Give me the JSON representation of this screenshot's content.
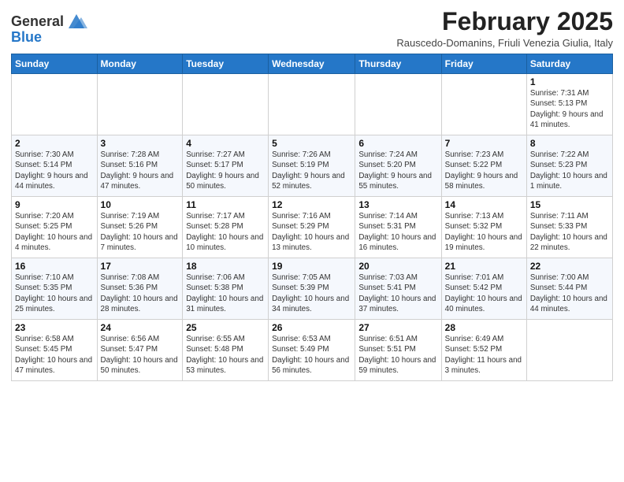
{
  "header": {
    "logo_general": "General",
    "logo_blue": "Blue",
    "month_title": "February 2025",
    "subtitle": "Rauscedo-Domanins, Friuli Venezia Giulia, Italy"
  },
  "weekdays": [
    "Sunday",
    "Monday",
    "Tuesday",
    "Wednesday",
    "Thursday",
    "Friday",
    "Saturday"
  ],
  "weeks": [
    [
      {
        "day": "",
        "info": ""
      },
      {
        "day": "",
        "info": ""
      },
      {
        "day": "",
        "info": ""
      },
      {
        "day": "",
        "info": ""
      },
      {
        "day": "",
        "info": ""
      },
      {
        "day": "",
        "info": ""
      },
      {
        "day": "1",
        "info": "Sunrise: 7:31 AM\nSunset: 5:13 PM\nDaylight: 9 hours and 41 minutes."
      }
    ],
    [
      {
        "day": "2",
        "info": "Sunrise: 7:30 AM\nSunset: 5:14 PM\nDaylight: 9 hours and 44 minutes."
      },
      {
        "day": "3",
        "info": "Sunrise: 7:28 AM\nSunset: 5:16 PM\nDaylight: 9 hours and 47 minutes."
      },
      {
        "day": "4",
        "info": "Sunrise: 7:27 AM\nSunset: 5:17 PM\nDaylight: 9 hours and 50 minutes."
      },
      {
        "day": "5",
        "info": "Sunrise: 7:26 AM\nSunset: 5:19 PM\nDaylight: 9 hours and 52 minutes."
      },
      {
        "day": "6",
        "info": "Sunrise: 7:24 AM\nSunset: 5:20 PM\nDaylight: 9 hours and 55 minutes."
      },
      {
        "day": "7",
        "info": "Sunrise: 7:23 AM\nSunset: 5:22 PM\nDaylight: 9 hours and 58 minutes."
      },
      {
        "day": "8",
        "info": "Sunrise: 7:22 AM\nSunset: 5:23 PM\nDaylight: 10 hours and 1 minute."
      }
    ],
    [
      {
        "day": "9",
        "info": "Sunrise: 7:20 AM\nSunset: 5:25 PM\nDaylight: 10 hours and 4 minutes."
      },
      {
        "day": "10",
        "info": "Sunrise: 7:19 AM\nSunset: 5:26 PM\nDaylight: 10 hours and 7 minutes."
      },
      {
        "day": "11",
        "info": "Sunrise: 7:17 AM\nSunset: 5:28 PM\nDaylight: 10 hours and 10 minutes."
      },
      {
        "day": "12",
        "info": "Sunrise: 7:16 AM\nSunset: 5:29 PM\nDaylight: 10 hours and 13 minutes."
      },
      {
        "day": "13",
        "info": "Sunrise: 7:14 AM\nSunset: 5:31 PM\nDaylight: 10 hours and 16 minutes."
      },
      {
        "day": "14",
        "info": "Sunrise: 7:13 AM\nSunset: 5:32 PM\nDaylight: 10 hours and 19 minutes."
      },
      {
        "day": "15",
        "info": "Sunrise: 7:11 AM\nSunset: 5:33 PM\nDaylight: 10 hours and 22 minutes."
      }
    ],
    [
      {
        "day": "16",
        "info": "Sunrise: 7:10 AM\nSunset: 5:35 PM\nDaylight: 10 hours and 25 minutes."
      },
      {
        "day": "17",
        "info": "Sunrise: 7:08 AM\nSunset: 5:36 PM\nDaylight: 10 hours and 28 minutes."
      },
      {
        "day": "18",
        "info": "Sunrise: 7:06 AM\nSunset: 5:38 PM\nDaylight: 10 hours and 31 minutes."
      },
      {
        "day": "19",
        "info": "Sunrise: 7:05 AM\nSunset: 5:39 PM\nDaylight: 10 hours and 34 minutes."
      },
      {
        "day": "20",
        "info": "Sunrise: 7:03 AM\nSunset: 5:41 PM\nDaylight: 10 hours and 37 minutes."
      },
      {
        "day": "21",
        "info": "Sunrise: 7:01 AM\nSunset: 5:42 PM\nDaylight: 10 hours and 40 minutes."
      },
      {
        "day": "22",
        "info": "Sunrise: 7:00 AM\nSunset: 5:44 PM\nDaylight: 10 hours and 44 minutes."
      }
    ],
    [
      {
        "day": "23",
        "info": "Sunrise: 6:58 AM\nSunset: 5:45 PM\nDaylight: 10 hours and 47 minutes."
      },
      {
        "day": "24",
        "info": "Sunrise: 6:56 AM\nSunset: 5:47 PM\nDaylight: 10 hours and 50 minutes."
      },
      {
        "day": "25",
        "info": "Sunrise: 6:55 AM\nSunset: 5:48 PM\nDaylight: 10 hours and 53 minutes."
      },
      {
        "day": "26",
        "info": "Sunrise: 6:53 AM\nSunset: 5:49 PM\nDaylight: 10 hours and 56 minutes."
      },
      {
        "day": "27",
        "info": "Sunrise: 6:51 AM\nSunset: 5:51 PM\nDaylight: 10 hours and 59 minutes."
      },
      {
        "day": "28",
        "info": "Sunrise: 6:49 AM\nSunset: 5:52 PM\nDaylight: 11 hours and 3 minutes."
      },
      {
        "day": "",
        "info": ""
      }
    ]
  ]
}
